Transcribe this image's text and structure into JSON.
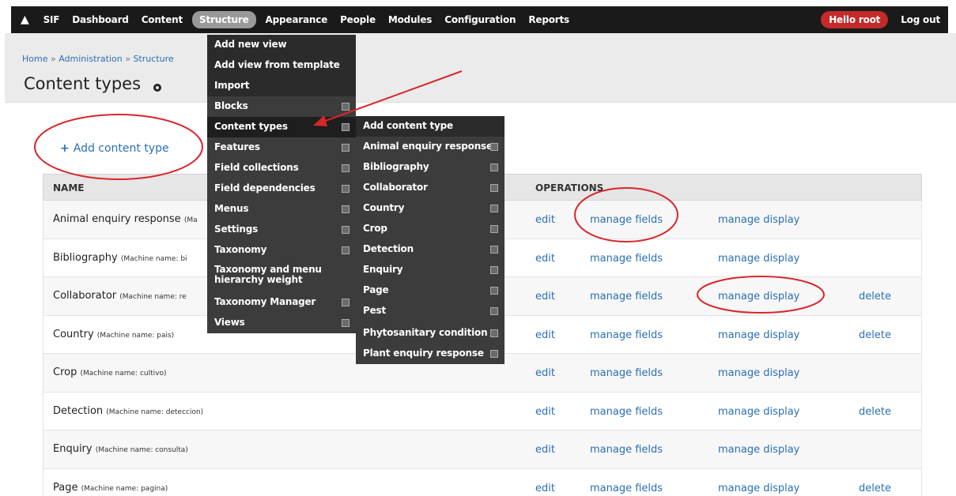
{
  "toolbar": {
    "items": [
      "SIF",
      "Dashboard",
      "Content",
      "Structure",
      "Appearance",
      "People",
      "Modules",
      "Configuration",
      "Reports"
    ],
    "user": "Hello root",
    "logout": "Log out",
    "home_icon": "home-icon"
  },
  "breadcrumb": [
    "Home",
    "Administration",
    "Structure"
  ],
  "breadcrumb_sep": "»",
  "title": "Content types",
  "add_link": {
    "plus": "+",
    "label": "Add content type"
  },
  "table": {
    "header_name": "NAME",
    "header_ops": "OPERATIONS",
    "rows": [
      {
        "name": "Animal enquiry response",
        "machine": "(Ma",
        "ops": [
          "edit",
          "manage fields",
          "manage display"
        ]
      },
      {
        "name": "Bibliography",
        "machine": "(Machine name: bi",
        "ops": [
          "edit",
          "manage fields",
          "manage display"
        ]
      },
      {
        "name": "Collaborator",
        "machine": "(Machine name: re",
        "ops": [
          "edit",
          "manage fields",
          "manage display",
          "delete"
        ]
      },
      {
        "name": "Country",
        "machine": "(Machine name: pais)",
        "ops": [
          "edit",
          "manage fields",
          "manage display",
          "delete"
        ]
      },
      {
        "name": "Crop",
        "machine": "(Machine name: cultivo)",
        "ops": [
          "edit",
          "manage fields",
          "manage display"
        ]
      },
      {
        "name": "Detection",
        "machine": "(Machine name: deteccion)",
        "ops": [
          "edit",
          "manage fields",
          "manage display",
          "delete"
        ]
      },
      {
        "name": "Enquiry",
        "machine": "(Machine name: consulta)",
        "ops": [
          "edit",
          "manage fields",
          "manage display"
        ]
      },
      {
        "name": "Page",
        "machine": "(Machine name: pagina)",
        "ops": [
          "edit",
          "manage fields",
          "manage display",
          "delete"
        ]
      }
    ]
  },
  "structure_menu": [
    "Add new view",
    "Add view from template",
    "Import",
    "Blocks",
    "Content types",
    "Features",
    "Field collections",
    "Field dependencies",
    "Menus",
    "Settings",
    "Taxonomy",
    "Taxonomy and menu hierarchy weight",
    "Taxonomy Manager",
    "Views"
  ],
  "content_types_menu": [
    "Add content type",
    "Animal enquiry response",
    "Bibliography",
    "Collaborator",
    "Country",
    "Crop",
    "Detection",
    "Enquiry",
    "Page",
    "Pest",
    "Phytosanitary condition",
    "Plant enquiry response"
  ],
  "colors": {
    "link": "#2a6fb5",
    "toolbar": "#1a1a1a",
    "user_badge": "#c42a2a",
    "annotation": "#d9262b"
  }
}
